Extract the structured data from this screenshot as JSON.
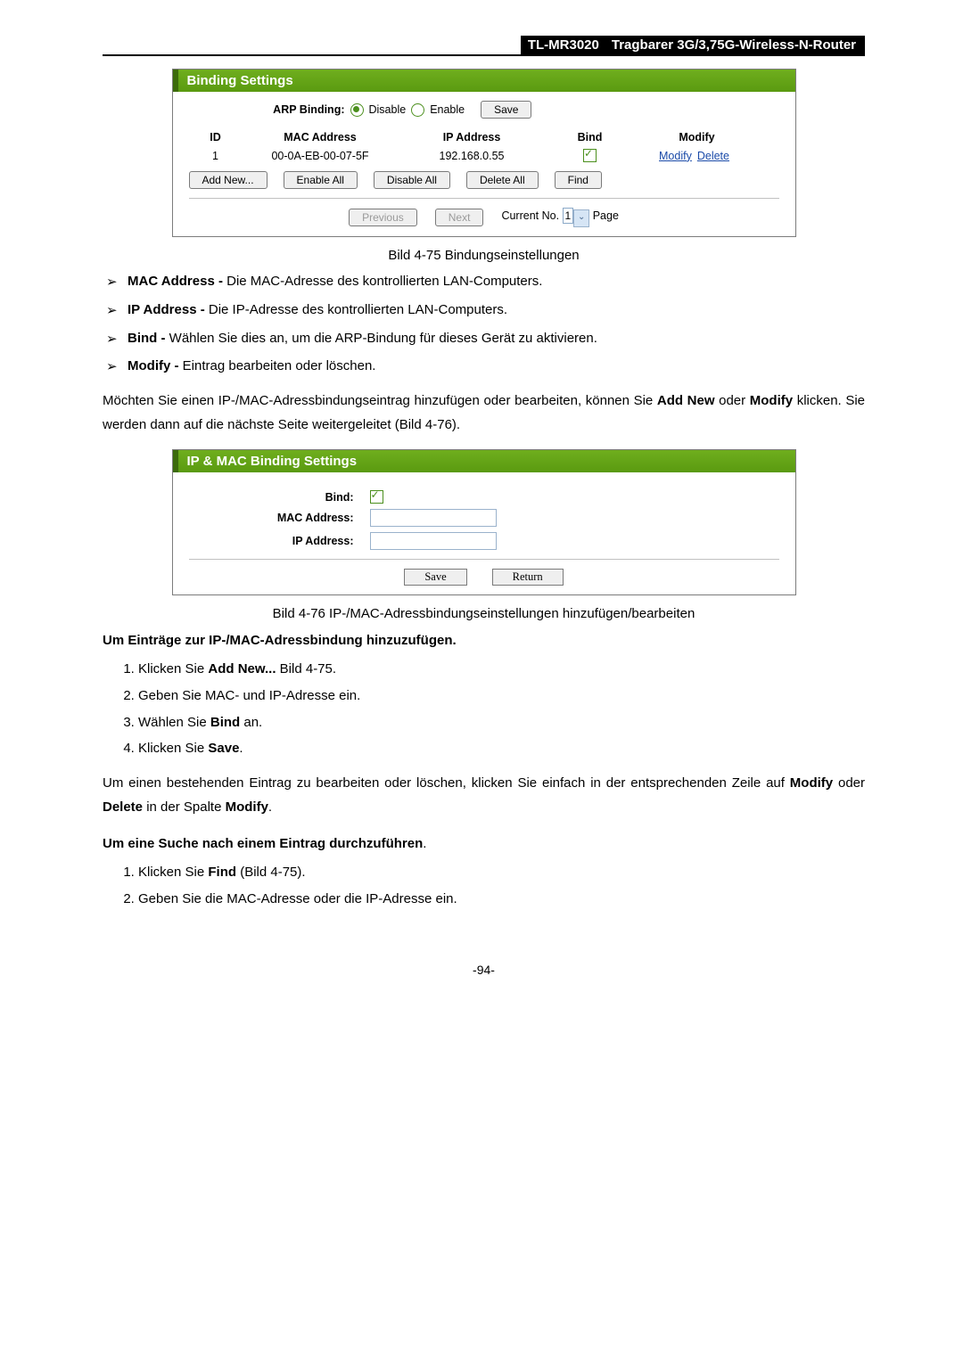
{
  "header": {
    "model": "TL-MR3020",
    "title": "Tragbarer 3G/3,75G-Wireless-N-Router"
  },
  "screenshot1": {
    "title": "Binding Settings",
    "arp_label": "ARP Binding:",
    "disable": "Disable",
    "enable": "Enable",
    "save": "Save",
    "cols": {
      "id": "ID",
      "mac": "MAC Address",
      "ip": "IP Address",
      "bind": "Bind",
      "modify": "Modify"
    },
    "rows": [
      {
        "id": "1",
        "mac": "00-0A-EB-00-07-5F",
        "ip": "192.168.0.55",
        "bind_checked": true,
        "modify": "Modify",
        "delete": "Delete"
      }
    ],
    "buttons": {
      "add": "Add New...",
      "enable_all": "Enable All",
      "disable_all": "Disable All",
      "delete_all": "Delete All",
      "find": "Find"
    },
    "pager": {
      "prev": "Previous",
      "next": "Next",
      "current_label": "Current No.",
      "current_value": "1",
      "page": "Page"
    }
  },
  "caption1": "Bild 4-75 Bindungseinstellungen",
  "bullets": [
    {
      "term": "MAC Address - ",
      "text": "Die MAC-Adresse des kontrollierten LAN-Computers."
    },
    {
      "term": "IP Address - ",
      "text": "Die IP-Adresse des kontrollierten LAN-Computers."
    },
    {
      "term": "Bind - ",
      "text": "Wählen Sie dies an, um die ARP-Bindung für dieses Gerät zu aktivieren."
    },
    {
      "term": "Modify - ",
      "text": "Eintrag bearbeiten oder löschen."
    }
  ],
  "para1a": "Möchten Sie einen IP-/MAC-Adressbindungseintrag hinzufügen oder bearbeiten, können Sie ",
  "para1b": "Add New",
  "para1c": " oder ",
  "para1d": "Modify",
  "para1e": " klicken. Sie werden dann auf die nächste Seite weitergeleitet (Bild 4-76).",
  "screenshot2": {
    "title": "IP & MAC Binding Settings",
    "bind": "Bind:",
    "mac": "MAC Address:",
    "ip": "IP Address:",
    "save": "Save",
    "return": "Return"
  },
  "caption2": "Bild 4-76 IP-/MAC-Adressbindungseinstellungen hinzufügen/bearbeiten",
  "heading1": "Um Einträge zur IP-/MAC-Adressbindung hinzuzufügen.",
  "ol1": [
    {
      "pre": "Klicken Sie ",
      "bold": "Add New...",
      "post": " Bild 4-75."
    },
    {
      "pre": "Geben Sie MAC- und IP-Adresse ein.",
      "bold": "",
      "post": ""
    },
    {
      "pre": "Wählen Sie ",
      "bold": "Bind",
      "post": " an."
    },
    {
      "pre": "Klicken Sie ",
      "bold": "Save",
      "post": "."
    }
  ],
  "para2a": "Um einen bestehenden Eintrag zu bearbeiten oder löschen, klicken Sie einfach in der entsprechenden Zeile auf ",
  "para2b": "Modify",
  "para2c": " oder ",
  "para2d": "Delete",
  "para2e": " in der Spalte ",
  "para2f": "Modify",
  "para2g": ".",
  "heading2": "Um eine Suche nach einem Eintrag durchzuführen",
  "heading2_tail": ".",
  "ol2": [
    {
      "pre": "Klicken Sie ",
      "bold": "Find",
      "post": " (Bild 4-75)."
    },
    {
      "pre": "Geben Sie die MAC-Adresse oder die IP-Adresse ein.",
      "bold": "",
      "post": ""
    }
  ],
  "footer": "-94-"
}
